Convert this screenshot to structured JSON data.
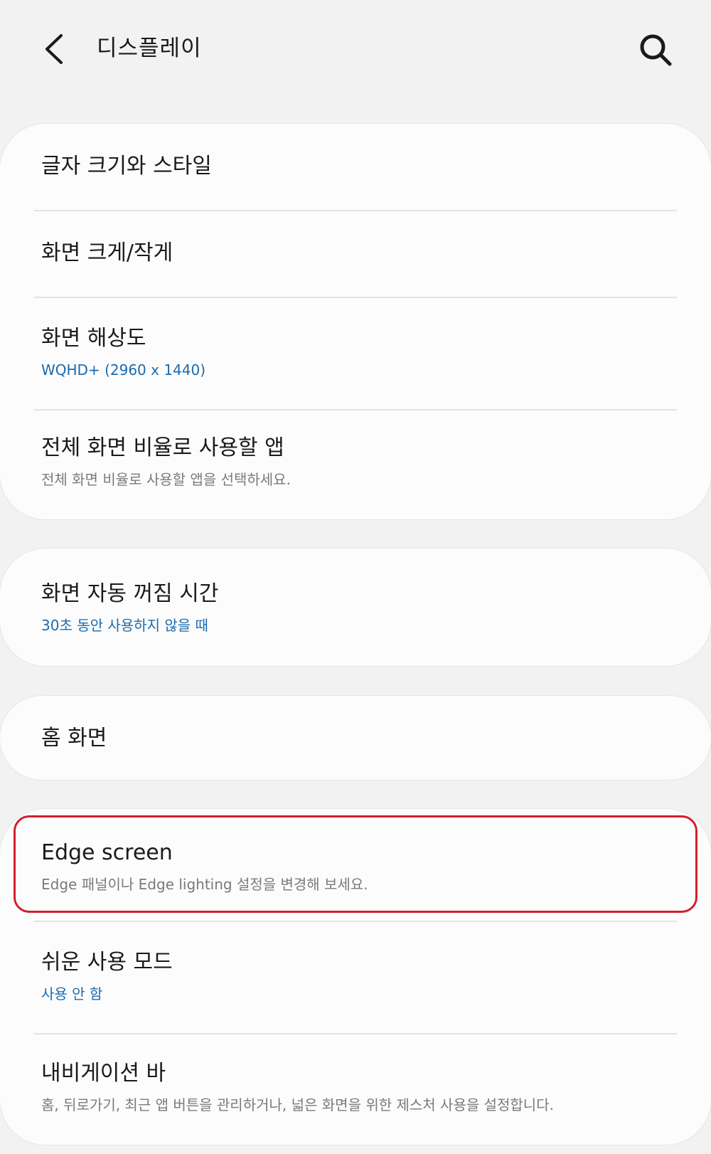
{
  "header": {
    "back_icon": "chevron-left-icon",
    "title": "디스플레이",
    "search_icon": "search-icon"
  },
  "groups": [
    {
      "items": [
        {
          "title": "글자 크기와 스타일"
        },
        {
          "title": "화면 크게/작게"
        },
        {
          "title": "화면 해상도",
          "subtitle": "WQHD+ (2960 x 1440)"
        },
        {
          "title": "전체 화면 비율로 사용할 앱",
          "subtitle": "전체 화면 비율로 사용할 앱을 선택하세요."
        }
      ]
    },
    {
      "items": [
        {
          "title": "화면 자동 꺼짐 시간",
          "subtitle": "30초 동안 사용하지 않을 때"
        }
      ]
    },
    {
      "items": [
        {
          "title": "홈 화면"
        }
      ]
    },
    {
      "items": [
        {
          "title": "Edge screen",
          "subtitle": "Edge 패널이나 Edge lighting 설정을 변경해 보세요."
        },
        {
          "title": "쉬운 사용 모드",
          "subtitle": "사용 안 함"
        },
        {
          "title": "내비게이션 바",
          "subtitle": "홈, 뒤로가기, 최근 앱 버튼을 관리하거나, 넓은 화면을 위한 제스처 사용을 설정합니다."
        }
      ]
    }
  ],
  "colors": {
    "background": "#f2f2f2",
    "card": "#fcfcfc",
    "accent_subtitle": "#1a6bb0",
    "muted_subtitle": "#7a7a7a",
    "highlight_border": "#d21f2e"
  }
}
